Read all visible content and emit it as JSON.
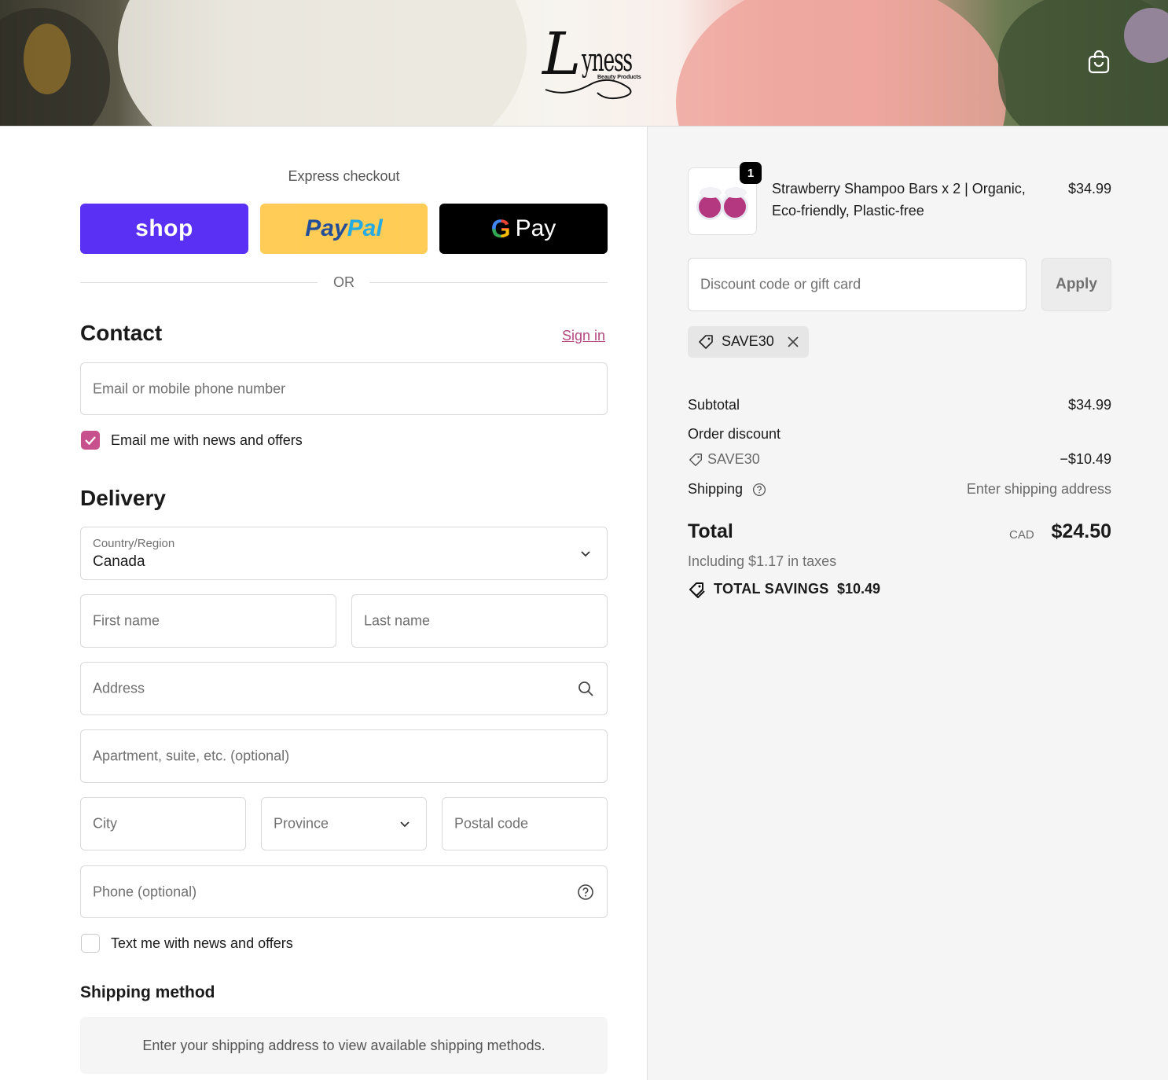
{
  "header": {
    "logo_script": "L",
    "logo_rest": "yness",
    "logo_subtitle": "Beauty Products"
  },
  "express": {
    "title": "Express checkout",
    "shop_label": "shop",
    "paypal_label_1": "Pay",
    "paypal_label_2": "Pal",
    "gpay_g": "G",
    "gpay_label": "Pay",
    "or_label": "OR"
  },
  "contact": {
    "heading": "Contact",
    "sign_in": "Sign in",
    "email_placeholder": "Email or mobile phone number",
    "news_label": "Email me with news and offers",
    "news_checked": true
  },
  "delivery": {
    "heading": "Delivery",
    "country_label": "Country/Region",
    "country_value": "Canada",
    "first_name": "First name",
    "last_name": "Last name",
    "address": "Address",
    "apartment": "Apartment, suite, etc. (optional)",
    "city": "City",
    "province": "Province",
    "postal": "Postal code",
    "phone": "Phone (optional)",
    "text_label": "Text me with news and offers",
    "text_checked": false
  },
  "shipping_method": {
    "heading": "Shipping method",
    "notice": "Enter your shipping address to view available shipping methods."
  },
  "summary": {
    "item": {
      "quantity": "1",
      "name_line1": "Strawberry Shampoo Bars x 2 | Organic,",
      "name_line2": "Eco-friendly, Plastic-free",
      "price": "$34.99"
    },
    "discount_placeholder": "Discount code or gift card",
    "apply_label": "Apply",
    "code_chip": "SAVE30",
    "subtotal_label": "Subtotal",
    "subtotal_value": "$34.99",
    "order_discount_label": "Order discount",
    "discount_code": "SAVE30",
    "discount_value": "−$10.49",
    "shipping_label": "Shipping",
    "shipping_value": "Enter shipping address",
    "total_label": "Total",
    "currency": "CAD",
    "total_value": "$24.50",
    "taxes_note": "Including $1.17 in taxes",
    "savings_label": "TOTAL SAVINGS",
    "savings_value": "$10.49"
  },
  "colors": {
    "shop_purple": "#5a31f4",
    "paypal_yellow": "#ffc439",
    "accent_pink": "#c7518c",
    "link_pink": "#b5487f"
  }
}
